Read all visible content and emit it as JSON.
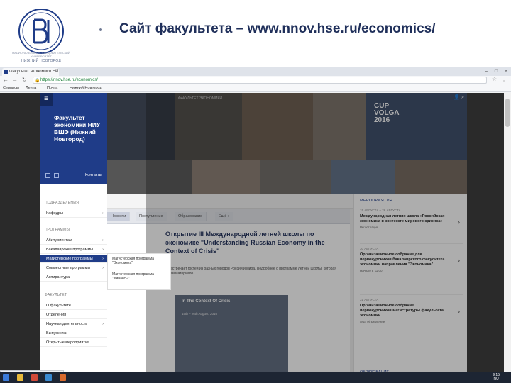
{
  "slide": {
    "title": "Сайт факультета – www.nnov.hse.ru/economics/",
    "logo_caption": "НАЦИОНАЛЬНЫЙ ИССЛЕДОВАТЕЛЬСКИЙ УНИВЕРСИТЕТ",
    "logo_city": "НИЖНИЙ НОВГОРОД"
  },
  "browser": {
    "tab_label": "Факультет экономики НИ",
    "url": "https://nnov.hse.ru/economics/",
    "bookmarks": [
      "Сервисы",
      "Лента",
      "Почта",
      "Нижний Новгород"
    ]
  },
  "sidebar": {
    "title": "Факультет экономики НИУ ВШЭ (Нижний Новгород)",
    "contacts": "Контакты",
    "section_units": "ПОДРАЗДЕЛЕНИЯ",
    "units": [
      "Кафедры"
    ],
    "section_programs": "ПРОГРАММЫ",
    "programs": [
      "Абитуриентам",
      "Бакалаврские программы",
      "Магистерские программы",
      "Совместные программы",
      "Аспирантура"
    ],
    "section_faculty": "ФАКУЛЬТЕТ",
    "faculty": [
      "О факультете",
      "Отделения",
      "Научная деятельность",
      "Выпускники",
      "Открытые мероприятия"
    ],
    "submenu": [
      "Магистерская программа \"Экономика\"",
      "Магистерская программа \"Финансы\""
    ]
  },
  "hero": {
    "strip_text": "ФАКУЛЬТЕТ ЭКОНОМИКИ",
    "cup_line1": "CUP",
    "cup_line2": "VOLGA",
    "cup_line3": "2016"
  },
  "news": {
    "tabs": [
      "Новости",
      "Поступление",
      "Образование",
      "Ещё ›"
    ],
    "headline": "Открытие III Международной летней школы по экономике \"Understanding Russian Economy in the Context of Crisis\"",
    "text": "Нижегородский кампус НИУ ВШЭ встречает гостей из разных городов России и мира. Подробнее о программе летней школы, которая пройдет с 15 по 26 августа, в нашем материале.",
    "image_title": "In The Context Of Crisis",
    "image_date": "15th – 26th August, 2016"
  },
  "events": {
    "heading": "МЕРОПРИЯТИЯ",
    "items": [
      {
        "date": "15 АВГУСТА – 26 АВГУСТА",
        "title": "Международная летняя школа «Российская экономика в контексте мирового кризиса»",
        "meta": "Регистрация"
      },
      {
        "date": "30 АВГУСТА",
        "title": "Организационное собрание для первокурсников бакалаврского факультета экономики направления \"Экономика\"",
        "meta": "Начало в 11:00"
      },
      {
        "date": "31 АВГУСТА",
        "title": "Организационное собрание первокурсников магистратуры факультета экономики",
        "meta": "Ауд. объявление"
      }
    ],
    "footer": "ОБРАЗОВАНИЕ"
  },
  "status_url": "https://nnov.hse.ru/economics/",
  "clock": {
    "time": "9:15",
    "date": "RU"
  }
}
